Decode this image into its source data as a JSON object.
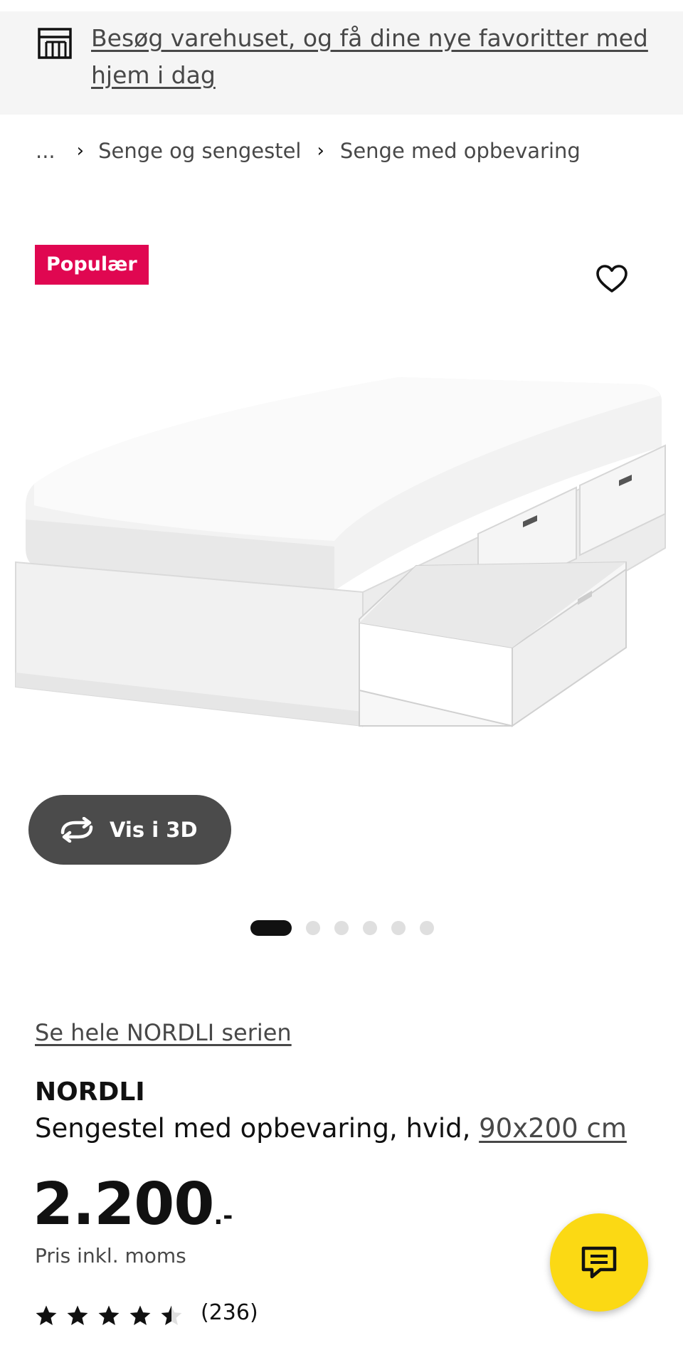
{
  "banner": {
    "icon": "store-icon",
    "text": "Besøg varehuset, og få dine nye favoritter med hjem i dag"
  },
  "breadcrumb": {
    "ellipsis": "...",
    "items": [
      "Senge og sengestel",
      "Senge med opbevaring"
    ],
    "separator": "›"
  },
  "product_image": {
    "badge": "Populær",
    "badge_color": "#e00751",
    "favorite_icon": "heart-outline-icon",
    "view_3d_label": "Vis i 3D",
    "view_3d_icon": "rotate-arrows-icon",
    "carousel": {
      "total": 6,
      "active_index": 0
    }
  },
  "product": {
    "series_link": "Se hele NORDLI serien",
    "name": "NORDLI",
    "description": "Sengestel med opbevaring, hvid, ",
    "size_link": "90x200 cm",
    "price": "2.200",
    "price_suffix": ".-",
    "price_note": "Pris inkl. moms",
    "rating": 4.5,
    "reviews": "(236)"
  },
  "chat": {
    "icon": "chat-bubble-icon",
    "color": "#fbd914"
  }
}
